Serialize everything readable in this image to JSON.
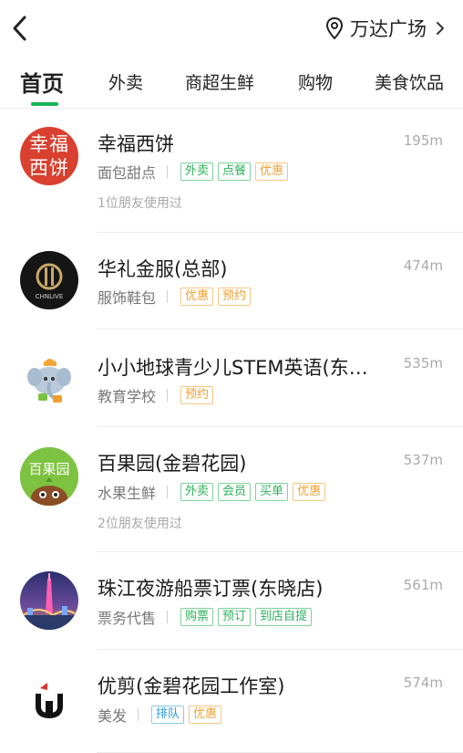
{
  "header": {
    "back_icon": "back-arrow-icon",
    "location_icon": "location-pin-icon",
    "location": "万达广场",
    "chevron_icon": "chevron-right-icon"
  },
  "tabs": [
    {
      "label": "首页",
      "active": true
    },
    {
      "label": "外卖",
      "active": false
    },
    {
      "label": "商超生鲜",
      "active": false
    },
    {
      "label": "购物",
      "active": false
    },
    {
      "label": "美食饮品",
      "active": false
    }
  ],
  "colors": {
    "accent_green": "#17b35a",
    "tag_green": "#2bb15a",
    "tag_orange": "#f0a030",
    "tag_blue": "#2f9ad8"
  },
  "shops": [
    {
      "name": "幸福西饼",
      "distance": "195m",
      "category": "面包甜点",
      "tags": [
        {
          "text": "外卖",
          "color": "green"
        },
        {
          "text": "点餐",
          "color": "green"
        },
        {
          "text": "优惠",
          "color": "orange"
        }
      ],
      "friends": "1位朋友使用过",
      "avatar": {
        "type": "logo-text",
        "lines": [
          "幸福",
          "西饼"
        ],
        "icon": "xingfu-xibing-logo"
      }
    },
    {
      "name": "华礼金服(总部)",
      "distance": "474m",
      "category": "服饰鞋包",
      "tags": [
        {
          "text": "优惠",
          "color": "orange"
        },
        {
          "text": "预约",
          "color": "orange"
        }
      ],
      "friends": "",
      "avatar": {
        "type": "logo",
        "text": "CHNLIVE",
        "icon": "huali-logo"
      }
    },
    {
      "name": "小小地球青少儿STEM英语(东…",
      "distance": "535m",
      "category": "教育学校",
      "tags": [
        {
          "text": "预约",
          "color": "orange"
        }
      ],
      "friends": "",
      "avatar": {
        "type": "illustration",
        "icon": "elephant-mascot-icon"
      }
    },
    {
      "name": "百果园(金碧花园)",
      "distance": "537m",
      "category": "水果生鲜",
      "tags": [
        {
          "text": "外卖",
          "color": "green"
        },
        {
          "text": "会员",
          "color": "green"
        },
        {
          "text": "买单",
          "color": "green"
        },
        {
          "text": "优惠",
          "color": "orange"
        }
      ],
      "friends": "2位朋友使用过",
      "avatar": {
        "type": "logo-text",
        "lines": [
          "百果园"
        ],
        "icon": "baiguoyuan-logo"
      }
    },
    {
      "name": "珠江夜游船票订票(东晓店)",
      "distance": "561m",
      "category": "票务代售",
      "tags": [
        {
          "text": "购票",
          "color": "green"
        },
        {
          "text": "预订",
          "color": "green"
        },
        {
          "text": "到店自提",
          "color": "green"
        }
      ],
      "friends": "",
      "avatar": {
        "type": "photo",
        "icon": "canton-tower-night-photo"
      }
    },
    {
      "name": "优剪(金碧花园工作室)",
      "distance": "574m",
      "category": "美发",
      "tags": [
        {
          "text": "排队",
          "color": "blue"
        },
        {
          "text": "优惠",
          "color": "orange"
        }
      ],
      "friends": "",
      "avatar": {
        "type": "logo",
        "icon": "youjian-logo"
      }
    }
  ]
}
